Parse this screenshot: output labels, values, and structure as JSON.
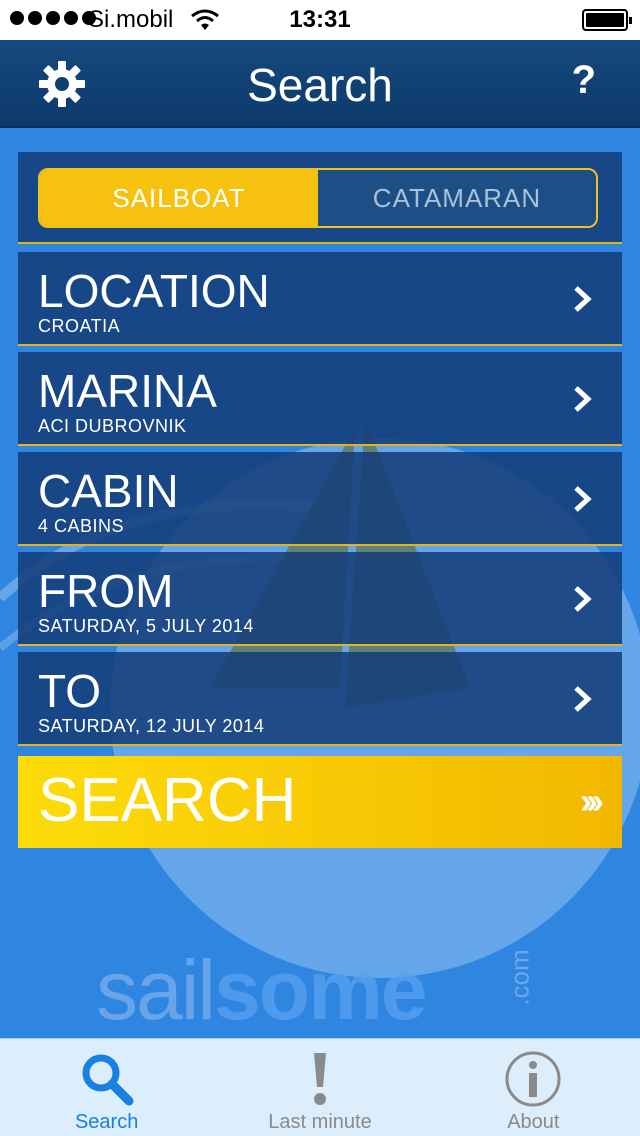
{
  "status_bar": {
    "carrier": "Si.mobil",
    "time": "13:31"
  },
  "nav": {
    "title": "Search",
    "help_label": "?",
    "settings_icon": "gear-icon"
  },
  "boat_type": {
    "options": [
      "SAILBOAT",
      "CATAMARAN"
    ],
    "selected": "SAILBOAT"
  },
  "fields": [
    {
      "label": "LOCATION",
      "value": "CROATIA"
    },
    {
      "label": "MARINA",
      "value": "ACI DUBROVNIK"
    },
    {
      "label": "CABIN",
      "value": "4 CABINS"
    },
    {
      "label": "FROM",
      "value": "SATURDAY, 5 JULY 2014"
    },
    {
      "label": "TO",
      "value": "SATURDAY, 12 JULY 2014"
    }
  ],
  "search_button": {
    "label": "SEARCH",
    "arrows": "›››"
  },
  "brand": {
    "part1": "sail",
    "part2": "some",
    "suffix": ".com"
  },
  "tabs": [
    {
      "label": "Search",
      "icon": "search-icon",
      "active": true
    },
    {
      "label": "Last minute",
      "icon": "exclamation-icon",
      "active": false
    },
    {
      "label": "About",
      "icon": "info-icon",
      "active": false
    }
  ],
  "colors": {
    "accent": "#f7c20f",
    "nav_bg": "#0d3a6b",
    "background": "#2f86e0",
    "tab_active": "#1780e0"
  }
}
